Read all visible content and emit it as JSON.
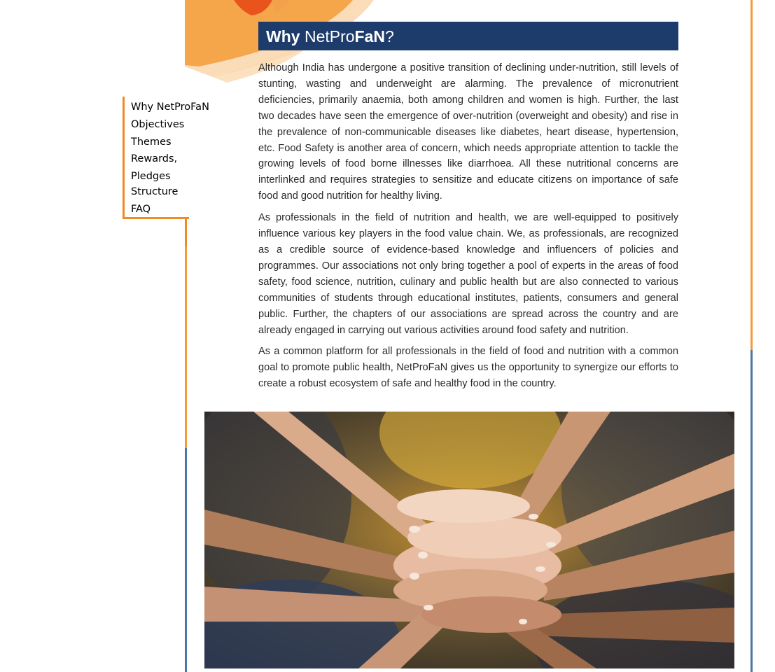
{
  "nav": {
    "items": [
      {
        "label": "Why NetProFaN"
      },
      {
        "label": "Objectives"
      },
      {
        "label": "Themes"
      },
      {
        "label": "Rewards,"
      },
      {
        "label": "Pledges"
      },
      {
        "label": "Structure"
      },
      {
        "label": "FAQ"
      }
    ]
  },
  "title": {
    "why": "Why",
    "net_pro": "NetPro",
    "fan": "FaN",
    "qmark": "?"
  },
  "paragraphs": [
    "Although India has undergone a positive transition of declining under-nutrition, still levels of stunting, wasting and underweight are alarming. The prevalence of micronutrient deficiencies, primarily anaemia, both among children and women is high. Further, the last two decades have seen the emergence of over-nutrition (overweight and obesity) and rise in the prevalence of non-communicable diseases like diabetes, heart disease, hypertension, etc. Food Safety is another area of concern, which needs appropriate attention to tackle the growing levels of food borne illnesses like diarrhoea. All these nutritional concerns are interlinked and requires strategies to sensitize and educate citizens on importance of safe food and good nutrition for healthy living.",
    "As professionals in the field of nutrition and health, we are well-equipped to positively influence various key players in the food value chain. We, as professionals, are recognized as a credible source of evidence-based knowledge and influencers of policies and programmes. Our associations not only bring together a pool of experts in the areas of food safety, food science, nutrition, culinary and public health but are also connected to various communities of students through educational institutes, patients, consumers and general public. Further, the chapters of our associations are spread across the country and are already engaged in carrying out various activities around food safety and nutrition.",
    "As a common platform for all professionals in the field of food and nutrition with a common goal to promote public health, NetProFaN gives us the opportunity to synergize our efforts to create a robust ecosystem of safe and healthy food in the country."
  ],
  "colors": {
    "title_bg": "#1d3b6b",
    "accent_orange": "#f08a24",
    "accent_blue": "#4d76a6"
  },
  "photo": {
    "subject": "stacked-hands-photo"
  }
}
